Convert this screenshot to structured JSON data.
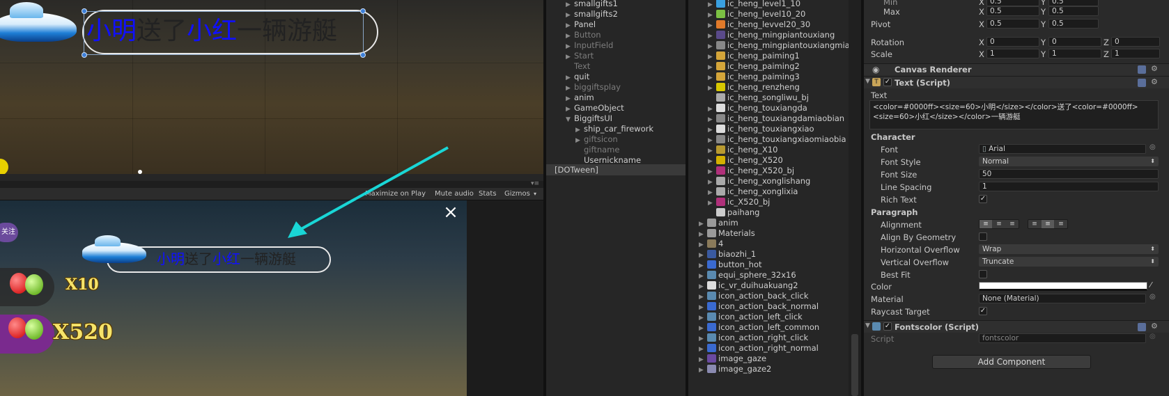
{
  "scene": {
    "banner_parts": [
      "小明",
      "送了",
      "小红",
      "一辆游艇"
    ]
  },
  "game_toolbar": {
    "maximize": "Maximize on Play",
    "mute": "Mute audio",
    "stats": "Stats",
    "gizmos": "Gizmos"
  },
  "game": {
    "banner_parts": [
      "小明",
      "送了",
      "小红",
      "一辆游艇"
    ],
    "follow_label": "关注",
    "close": "×",
    "mult1": "X10",
    "mult2": "X520"
  },
  "hierarchy": {
    "items": [
      {
        "label": "smallgifts1",
        "arrow": "▶",
        "dim": false
      },
      {
        "label": "smallgifts2",
        "arrow": "▶",
        "dim": false
      },
      {
        "label": "Panel",
        "arrow": "▶",
        "dim": false
      },
      {
        "label": "Button",
        "arrow": "▶",
        "dim": true
      },
      {
        "label": "InputField",
        "arrow": "▶",
        "dim": true
      },
      {
        "label": "Start",
        "arrow": "▶",
        "dim": true
      },
      {
        "label": "Text",
        "arrow": "",
        "dim": true
      },
      {
        "label": "quit",
        "arrow": "▶",
        "dim": false
      },
      {
        "label": "biggiftsplay",
        "arrow": "▶",
        "dim": true
      },
      {
        "label": "anim",
        "arrow": "▶",
        "dim": false
      },
      {
        "label": "GameObject",
        "arrow": "▶",
        "dim": false
      },
      {
        "label": "BiggiftsUI",
        "arrow": "▼",
        "dim": false
      },
      {
        "label": "ship_car_firework",
        "arrow": "▶",
        "dim": false
      },
      {
        "label": "giftsicon",
        "arrow": "▶",
        "dim": true
      },
      {
        "label": "giftname",
        "arrow": "",
        "dim": true
      },
      {
        "label": "Usernickname",
        "arrow": "",
        "dim": false
      }
    ],
    "dotween": "[DOTween]"
  },
  "project": {
    "items": [
      "ic_heng_level1_10",
      "ic_heng_level10_20",
      "ic_heng_levvel20_30",
      "ic_heng_mingpiantouxiang",
      "ic_heng_mingpiantouxiangmia",
      "ic_heng_paiming1",
      "ic_heng_paiming2",
      "ic_heng_paiming3",
      "ic_heng_renzheng",
      "ic_heng_songliwu_bj",
      "ic_heng_touxiangda",
      "ic_heng_touxiangdamiaobian",
      "ic_heng_touxiangxiao",
      "ic_heng_touxiangxiaomiaobia",
      "ic_heng_X10",
      "ic_heng_X520",
      "ic_heng_X520_bj",
      "ic_heng_xonglishang",
      "ic_heng_xonglixia",
      "ic_X520_bj",
      "paihang",
      "anim",
      "Materials",
      "4",
      "biaozhi_1",
      "button_hot",
      "equi_sphere_32x16",
      "ic_vr_duihuakuang2",
      "icon_action_back_click",
      "icon_action_back_normal",
      "icon_action_left_click",
      "icon_action_left_common",
      "icon_action_right_click",
      "icon_action_right_normal",
      "image_gaze",
      "image_gaze2"
    ]
  },
  "inspector": {
    "min_label": "Min",
    "max_label": "Max",
    "pivot_label": "Pivot",
    "rotation_label": "Rotation",
    "scale_label": "Scale",
    "x": "X",
    "y": "Y",
    "z": "Z",
    "min_x": "0.5",
    "min_y": "0.5",
    "max_x": "0.5",
    "max_y": "0.5",
    "pivot_x": "0.5",
    "pivot_y": "0.5",
    "rot_x": "0",
    "rot_y": "0",
    "rot_z": "0",
    "scale_x": "1",
    "scale_y": "1",
    "scale_z": "1",
    "canvas_renderer": "Canvas Renderer",
    "text_script": "Text (Script)",
    "text_label": "Text",
    "text_line1": "<color=#0000ff><size=60>小明</size></color>送了<color=#0000ff>",
    "text_line2": "<size=60>小红</size></color>一辆游艇",
    "character": "Character",
    "font_label": "Font",
    "font_value": "Arial",
    "font_style_label": "Font Style",
    "font_style_value": "Normal",
    "font_size_label": "Font Size",
    "font_size_value": "50",
    "line_spacing_label": "Line Spacing",
    "line_spacing_value": "1",
    "rich_text_label": "Rich Text",
    "paragraph": "Paragraph",
    "alignment_label": "Alignment",
    "align_geom_label": "Align By Geometry",
    "h_overflow_label": "Horizontal Overflow",
    "h_overflow_value": "Wrap",
    "v_overflow_label": "Vertical Overflow",
    "v_overflow_value": "Truncate",
    "best_fit_label": "Best Fit",
    "color_label": "Color",
    "material_label": "Material",
    "material_value": "None (Material)",
    "raycast_label": "Raycast Target",
    "fontscolor_script": "Fontscolor (Script)",
    "script_label": "Script",
    "script_value": "fontscolor",
    "add_component": "Add Component"
  }
}
